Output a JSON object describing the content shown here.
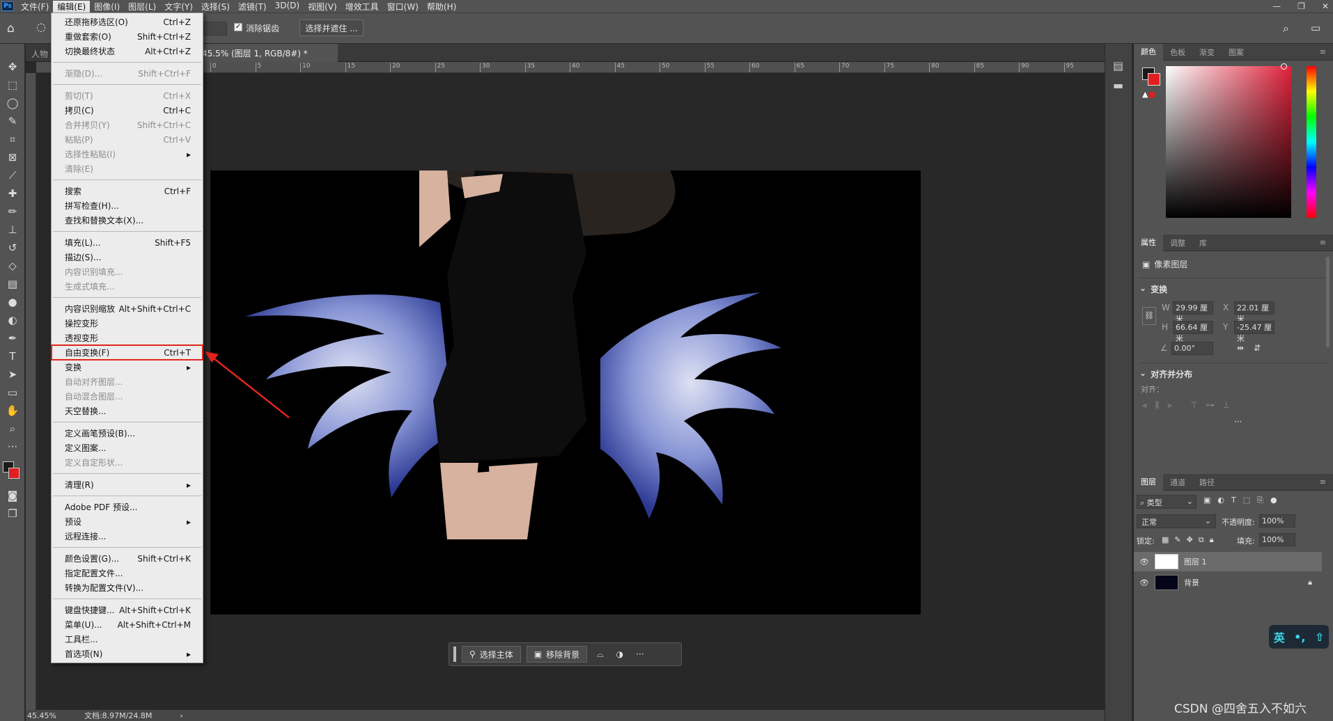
{
  "app": {
    "logo": "Ps"
  },
  "menubar": [
    "文件(F)",
    "编辑(E)",
    "图像(I)",
    "图层(L)",
    "文字(Y)",
    "选择(S)",
    "滤镜(T)",
    "3D(D)",
    "视图(V)",
    "增效工具",
    "窗口(W)",
    "帮助(H)"
  ],
  "window_controls": [
    "—",
    "❐",
    "✕"
  ],
  "options": {
    "anti_alias": "消除锯齿",
    "select_mask": "选择并遮住 ..."
  },
  "tabs": {
    "first": "人物",
    "active": ".jpg @ 45.5% (图层 1, RGB/8#) *"
  },
  "ruler_ticks": [
    "0",
    "5",
    "10",
    "15",
    "20",
    "25",
    "30",
    "35",
    "40",
    "45",
    "50",
    "55",
    "60",
    "65",
    "70",
    "75",
    "80",
    "85",
    "90",
    "95"
  ],
  "edit_menu": [
    {
      "label": "还原拖移选区(O)",
      "shortcut": "Ctrl+Z"
    },
    {
      "label": "重做套索(O)",
      "shortcut": "Shift+Ctrl+Z"
    },
    {
      "label": "切换最终状态",
      "shortcut": "Alt+Ctrl+Z"
    },
    {
      "sep": true
    },
    {
      "label": "渐隐(D)...",
      "shortcut": "Shift+Ctrl+F",
      "disabled": true
    },
    {
      "sep": true
    },
    {
      "label": "剪切(T)",
      "shortcut": "Ctrl+X",
      "disabled": true
    },
    {
      "label": "拷贝(C)",
      "shortcut": "Ctrl+C"
    },
    {
      "label": "合并拷贝(Y)",
      "shortcut": "Shift+Ctrl+C",
      "disabled": true
    },
    {
      "label": "粘贴(P)",
      "shortcut": "Ctrl+V",
      "disabled": true
    },
    {
      "label": "选择性粘贴(I)",
      "submenu": true,
      "disabled": true
    },
    {
      "label": "清除(E)",
      "disabled": true
    },
    {
      "sep": true
    },
    {
      "label": "搜索",
      "shortcut": "Ctrl+F"
    },
    {
      "label": "拼写检查(H)..."
    },
    {
      "label": "查找和替换文本(X)..."
    },
    {
      "sep": true
    },
    {
      "label": "填充(L)...",
      "shortcut": "Shift+F5"
    },
    {
      "label": "描边(S)..."
    },
    {
      "label": "内容识别填充...",
      "disabled": true
    },
    {
      "label": "生成式填充...",
      "disabled": true
    },
    {
      "sep": true
    },
    {
      "label": "内容识别缩放",
      "shortcut": "Alt+Shift+Ctrl+C"
    },
    {
      "label": "操控变形"
    },
    {
      "label": "透视变形"
    },
    {
      "label": "自由变换(F)",
      "shortcut": "Ctrl+T",
      "highlight": true
    },
    {
      "label": "变换",
      "submenu": true
    },
    {
      "label": "自动对齐图层...",
      "disabled": true
    },
    {
      "label": "自动混合图层...",
      "disabled": true
    },
    {
      "label": "天空替换..."
    },
    {
      "sep": true
    },
    {
      "label": "定义画笔预设(B)..."
    },
    {
      "label": "定义图案..."
    },
    {
      "label": "定义自定形状...",
      "disabled": true
    },
    {
      "sep": true
    },
    {
      "label": "清理(R)",
      "submenu": true
    },
    {
      "sep": true
    },
    {
      "label": "Adobe PDF 预设..."
    },
    {
      "label": "预设",
      "submenu": true
    },
    {
      "label": "远程连接..."
    },
    {
      "sep": true
    },
    {
      "label": "颜色设置(G)...",
      "shortcut": "Shift+Ctrl+K"
    },
    {
      "label": "指定配置文件..."
    },
    {
      "label": "转换为配置文件(V)..."
    },
    {
      "sep": true
    },
    {
      "label": "键盘快捷键...",
      "shortcut": "Alt+Shift+Ctrl+K"
    },
    {
      "label": "菜单(U)...",
      "shortcut": "Alt+Shift+Ctrl+M"
    },
    {
      "label": "工具栏..."
    },
    {
      "label": "首选项(N)",
      "submenu": true
    }
  ],
  "context_bar": {
    "select_subject": "选择主体",
    "remove_bg": "移除背景",
    "more": "···"
  },
  "status": {
    "zoom": "45.45%",
    "doc": "文档:8.97M/24.8M"
  },
  "color_panel": {
    "tabs": [
      "颜色",
      "色板",
      "渐变",
      "图案"
    ],
    "fg": "#1a1a1a",
    "bg": "#e01f1f",
    "hue": "#e0223b"
  },
  "properties": {
    "tabs": [
      "属性",
      "调整",
      "库"
    ],
    "kind": "像素图层",
    "transform_title": "变换",
    "w_label": "W",
    "w": "29.99 厘米",
    "x_label": "X",
    "x": "22.01 厘米",
    "h_label": "H",
    "h": "66.64 厘米",
    "y_label": "Y",
    "y": "-25.47 厘米",
    "angle": "0.00°",
    "align_title": "对齐并分布",
    "align_label": "对齐："
  },
  "layers": {
    "tabs": [
      "图层",
      "通道",
      "路径"
    ],
    "filter": "类型",
    "blend": "正常",
    "opacity_label": "不透明度:",
    "opacity": "100%",
    "lock_label": "锁定:",
    "fill_label": "填充:",
    "fill": "100%",
    "items": [
      {
        "name": "图层 1",
        "selected": true
      },
      {
        "name": "背景",
        "locked": true
      }
    ]
  },
  "ime": {
    "lang": "英",
    "punct": "•,",
    "icon": "⇧"
  },
  "watermark": "CSDN @四舍五入不如六"
}
